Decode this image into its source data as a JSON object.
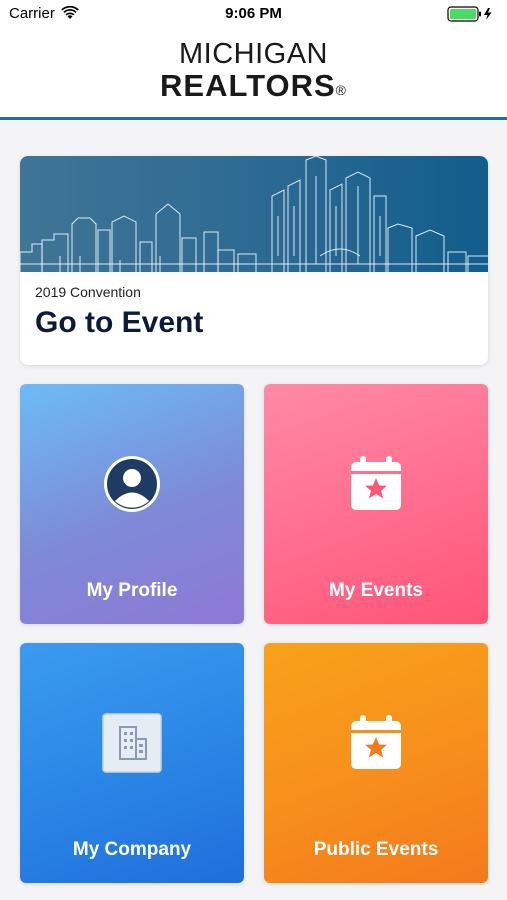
{
  "status_bar": {
    "carrier": "Carrier",
    "time": "9:06 PM",
    "wifi_icon": "wifi-icon",
    "battery_icon": "battery-charging-icon"
  },
  "header": {
    "logo_line1": "MICHIGAN",
    "logo_line2": "REALTORS",
    "logo_mark": "®",
    "accent_color": "#1b6fa8"
  },
  "event_card": {
    "subtitle": "2019 Convention",
    "title": "Go to Event",
    "banner_image": "detroit-skyline-illustration"
  },
  "tiles": [
    {
      "label": "My Profile",
      "icon": "user-circle-icon",
      "color": "#8e78d6"
    },
    {
      "label": "My Events",
      "icon": "calendar-star-icon",
      "color": "#ff5577"
    },
    {
      "label": "My Company",
      "icon": "building-icon",
      "color": "#1f6edb"
    },
    {
      "label": "Public Events",
      "icon": "calendar-star-icon",
      "color": "#f47a1c"
    }
  ]
}
